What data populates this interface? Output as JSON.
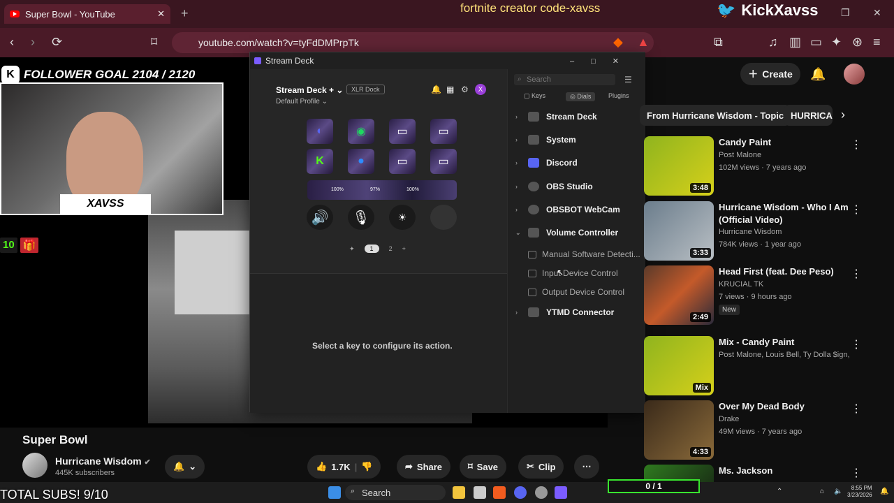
{
  "browser": {
    "tab_title": "Super Bowl - YouTube",
    "url": "youtube.com/watch?v=tyFdDMPrpTk",
    "new_tab": "+"
  },
  "overlay": {
    "creator_code": "fortnite creator code-xavss",
    "twitter_handle": "KickXavss",
    "follower_goal": "FOLLOWER GOAL 2104 / 2120",
    "webcam_tag": "XAVSS",
    "kick_count": "10",
    "total_subs": "TOTAL SUBS! 9/10",
    "goal_bar": "0 / 1"
  },
  "stream_deck": {
    "window_title": "Stream Deck",
    "device_name": "Stream Deck +",
    "device_badge": "XLR Dock",
    "profile": "Default Profile",
    "user_initial": "X",
    "strip_labels": [
      "100%",
      "97%",
      "100%"
    ],
    "pages": [
      "1",
      "2",
      "+"
    ],
    "hint": "Select a key to configure its action.",
    "search_placeholder": "Search",
    "tabs": [
      "Keys",
      "Dials",
      "Plugins"
    ],
    "categories": [
      {
        "label": "Stream Deck",
        "chevron": "›"
      },
      {
        "label": "System",
        "chevron": "›"
      },
      {
        "label": "Discord",
        "chevron": "›"
      },
      {
        "label": "OBS Studio",
        "chevron": "›"
      },
      {
        "label": "OBSBOT WebCam",
        "chevron": "›"
      },
      {
        "label": "Volume Controller",
        "chevron": "⌄"
      },
      {
        "label": "YTMD Connector",
        "chevron": "›"
      }
    ],
    "subitems": [
      "Manual Software Detecti...",
      "Input Device Control",
      "Output Device Control"
    ]
  },
  "youtube": {
    "create_label": "Create",
    "chips": [
      "From Hurricane Wisdom - Topic",
      "HURRICA"
    ],
    "recommendations": [
      {
        "title": "Candy Paint",
        "channel": "Post Malone",
        "meta": "102M views · 7 years ago",
        "duration": "3:48"
      },
      {
        "title": "Hurricane Wisdom - Who I Am (Official Video)",
        "channel": "Hurricane Wisdom",
        "meta": "784K views · 1 year ago",
        "duration": "3:33"
      },
      {
        "title": "Head First (feat. Dee Peso)",
        "channel": "KRUCIAL TK",
        "meta": "7 views · 9 hours ago",
        "duration": "2:49",
        "badge": "New"
      },
      {
        "title": "Mix - Candy Paint",
        "channel": "Post Malone, Louis Bell, Ty Dolla $ign, an...",
        "meta": "",
        "duration": "Mix"
      },
      {
        "title": "Over My Dead Body",
        "channel": "Drake",
        "meta": "49M views · 7 years ago",
        "duration": "4:33"
      },
      {
        "title": "Ms. Jackson",
        "channel": "",
        "meta": "",
        "duration": ""
      }
    ],
    "video_title": "Super Bowl",
    "channel_name": "Hurricane Wisdom",
    "subscribers": "445K subscribers",
    "like_count": "1.7K",
    "share_label": "Share",
    "save_label": "Save",
    "clip_label": "Clip"
  },
  "taskbar": {
    "search_label": "Search",
    "time": "8:55 PM",
    "date": "3/23/2026"
  }
}
